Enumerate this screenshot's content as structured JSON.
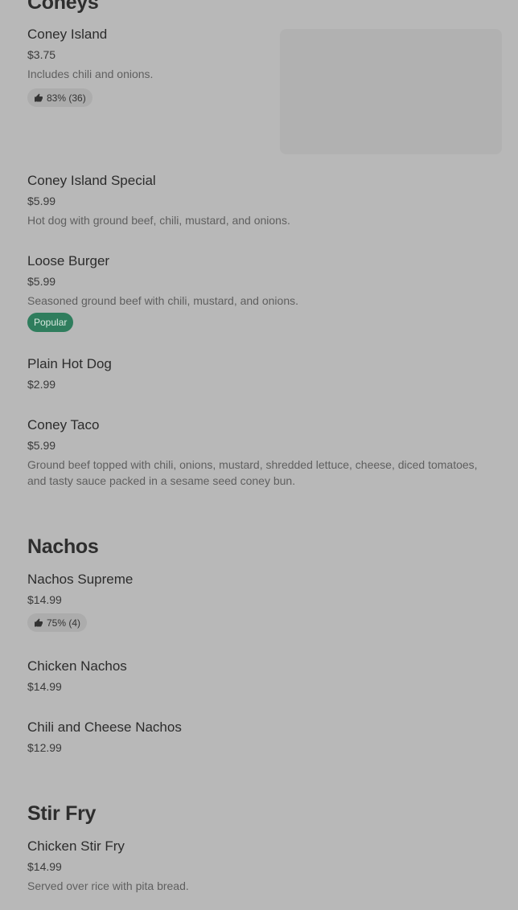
{
  "sections": [
    {
      "title": "Coneys",
      "items": [
        {
          "name": "Coney Island",
          "price": "$3.75",
          "description": "Includes chili and onions.",
          "rating": "83% (36)"
        },
        {
          "name": "Coney Island Special",
          "price": "$5.99",
          "description": "Hot dog with ground beef, chili, mustard, and onions."
        },
        {
          "name": "Loose Burger",
          "price": "$5.99",
          "description": "Seasoned ground beef with chili, mustard, and onions.",
          "badge": "Popular"
        },
        {
          "name": "Plain Hot Dog",
          "price": "$2.99"
        },
        {
          "name": "Coney Taco",
          "price": "$5.99",
          "description": "Ground beef topped with chili, onions, mustard, shredded lettuce, cheese, diced tomatoes, and tasty sauce packed in a sesame seed coney bun."
        }
      ]
    },
    {
      "title": "Nachos",
      "items": [
        {
          "name": "Nachos Supreme",
          "price": "$14.99",
          "rating": "75% (4)"
        },
        {
          "name": "Chicken Nachos",
          "price": "$14.99"
        },
        {
          "name": "Chili and Cheese Nachos",
          "price": "$12.99"
        }
      ]
    },
    {
      "title": "Stir Fry",
      "items": [
        {
          "name": "Chicken Stir Fry",
          "price": "$14.99",
          "description": "Served over rice with pita bread."
        }
      ]
    }
  ],
  "colors": {
    "overlay_bg": "#b8b8b8",
    "popular_badge": "#2f7d5d"
  },
  "icons": {
    "rating": "thumbs-up-icon"
  }
}
